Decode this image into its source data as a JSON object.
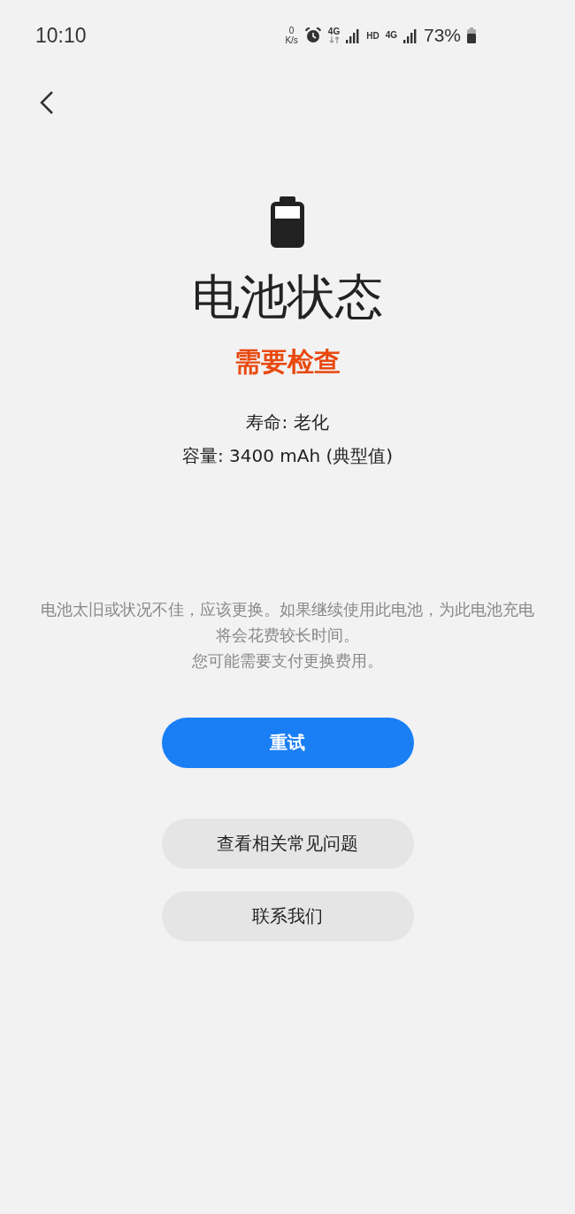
{
  "status_bar": {
    "time": "10:10",
    "net_speed_value": "0",
    "net_speed_unit": "K/s",
    "network_1": "4G",
    "hd": "HD",
    "network_2": "4G",
    "battery": "73%"
  },
  "title": "电池状态",
  "status": "需要检查",
  "details": [
    "寿命: 老化",
    "容量: 3400 mAh (典型值)"
  ],
  "description": [
    "电池太旧或状况不佳，应该更换。如果继续使用此电池，为此电池充电将会花费较长时间。",
    "您可能需要支付更换费用。"
  ],
  "buttons": [
    {
      "label": "重试",
      "kind": "primary"
    },
    {
      "label": "查看相关常见问题",
      "kind": "secondary"
    },
    {
      "label": "联系我们",
      "kind": "secondary"
    }
  ]
}
